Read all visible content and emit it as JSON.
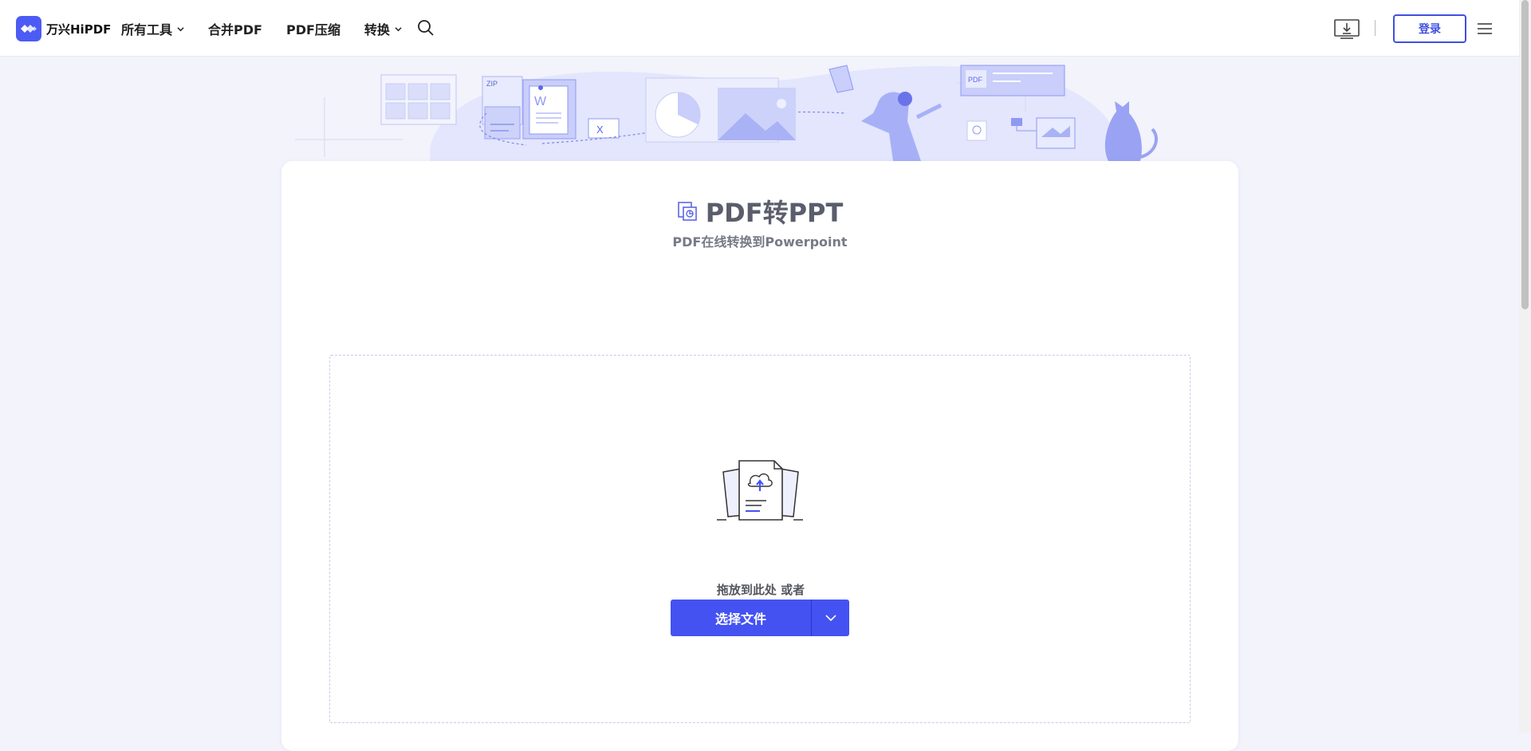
{
  "header": {
    "logo_text": "万兴HiPDF",
    "nav": [
      {
        "label": "所有工具",
        "has_dropdown": true
      },
      {
        "label": "合并PDF",
        "has_dropdown": false
      },
      {
        "label": "PDF压缩",
        "has_dropdown": false
      },
      {
        "label": "转换",
        "has_dropdown": true
      }
    ],
    "login_label": "登录",
    "icons": {
      "search": "search-icon",
      "download": "download-desktop-icon",
      "menu": "hamburger-menu-icon"
    }
  },
  "banner": {
    "zip_label": "ZIP",
    "pdf_label": "PDF",
    "word_label": "W",
    "excel_label": "X"
  },
  "tool": {
    "title": "PDF转PPT",
    "subtitle": "PDF在线转换到Powerpoint",
    "drop_text": "拖放到此处 或者",
    "select_button": "选择文件"
  },
  "colors": {
    "accent": "#4452f2",
    "login_border": "#3f4fe0",
    "page_bg": "#f2f3fb",
    "illustration": "#8f98f3"
  }
}
